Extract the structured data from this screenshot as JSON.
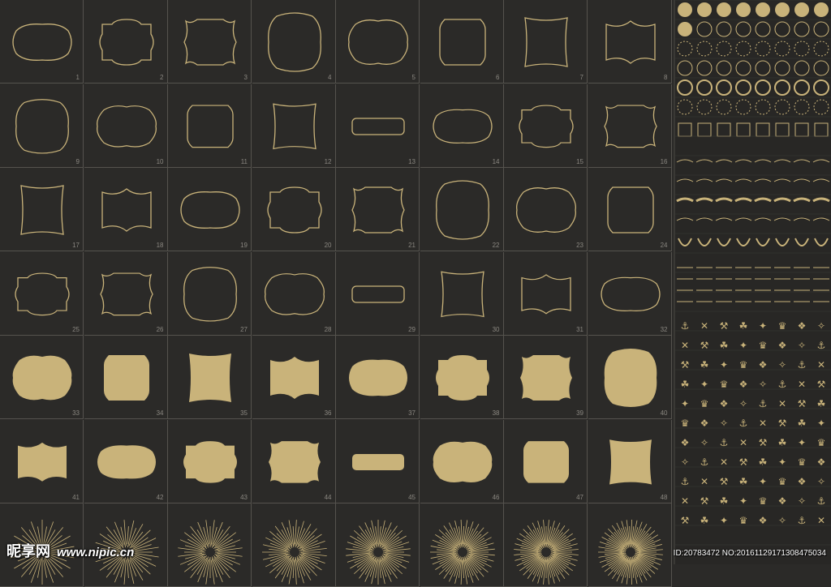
{
  "colors": {
    "gold": "#c9b37a",
    "background": "#2b2a28",
    "grid_line": "#55534e",
    "number": "#8a8780"
  },
  "frames": {
    "labels": [
      "1",
      "2",
      "3",
      "4",
      "5",
      "6",
      "7",
      "8",
      "9",
      "10",
      "11",
      "12",
      "13",
      "14",
      "15",
      "16",
      "17",
      "18",
      "19",
      "20",
      "21",
      "22",
      "23",
      "24",
      "25",
      "26",
      "27",
      "28",
      "29",
      "30",
      "31",
      "32",
      "33",
      "34",
      "35",
      "36",
      "37",
      "38",
      "39",
      "40",
      "41",
      "42",
      "43",
      "44",
      "45",
      "46",
      "47",
      "48"
    ]
  },
  "watermark": {
    "site": "昵享网",
    "url": "www.nipic.cn",
    "id_text": "ID:20783472 NO:20161129171308475034"
  }
}
